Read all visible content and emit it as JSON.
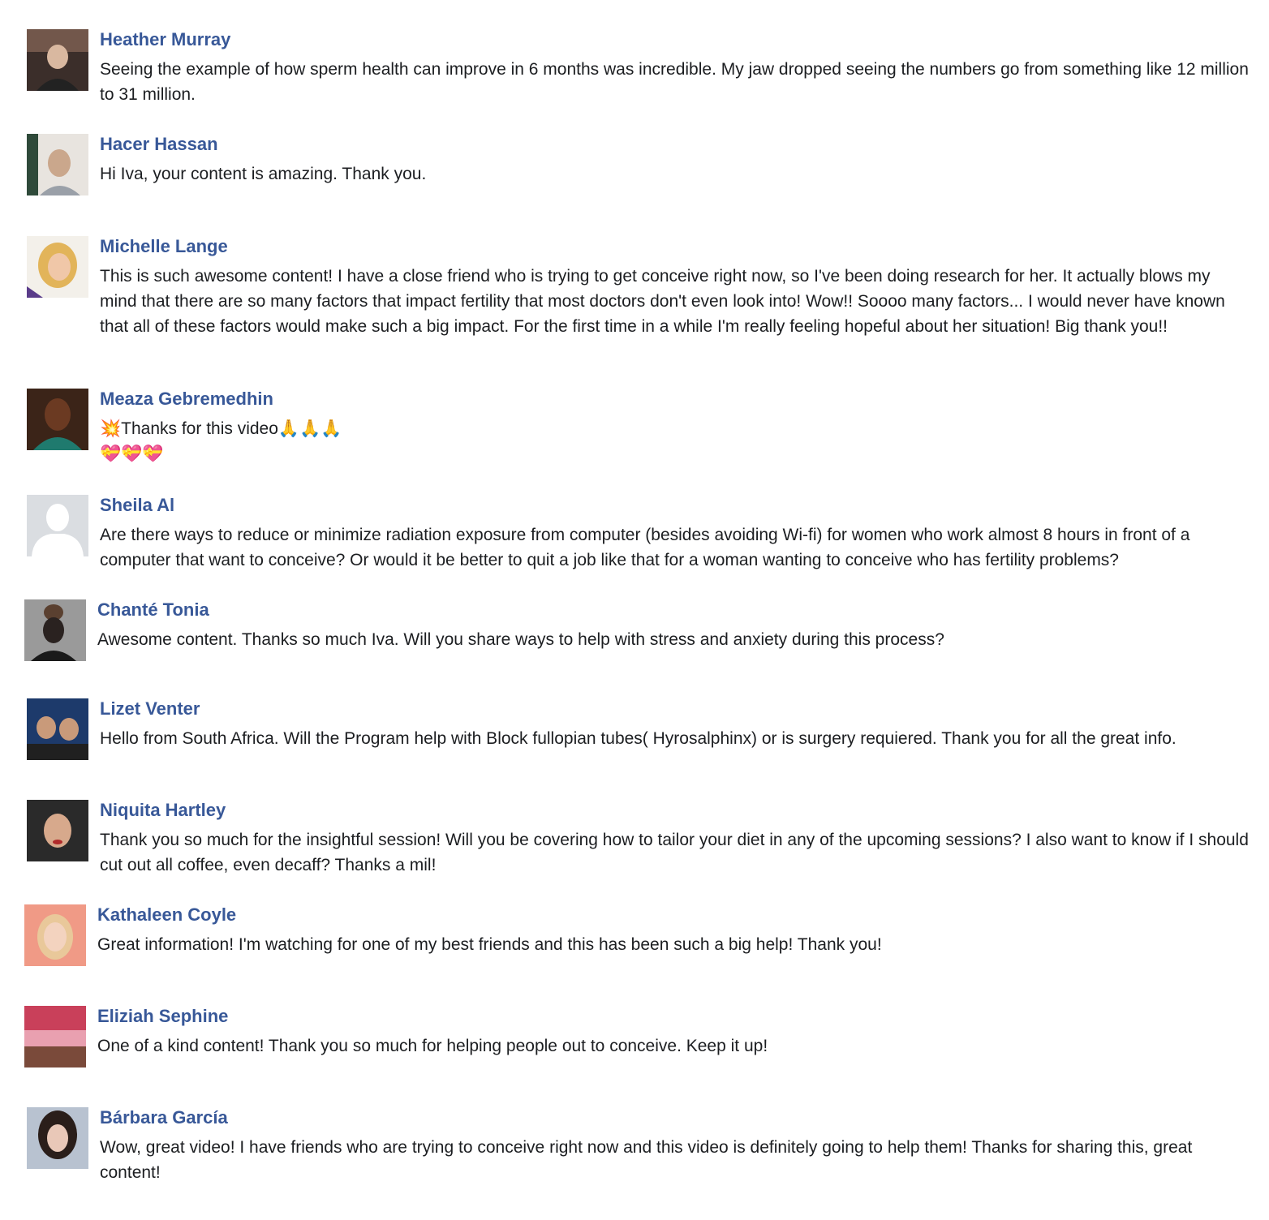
{
  "comments": [
    {
      "name": "Heather Murray",
      "text": "Seeing the example of how sperm health can improve in 6 months was incredible. My jaw dropped seeing the numbers go from something like 12 million to 31 million.",
      "avatar_colors": [
        "#3b2e2a",
        "#8a6a5a",
        "#d9b8a0"
      ]
    },
    {
      "name": "Hacer Hassan",
      "text": "Hi Iva, your content is amazing. Thank you.",
      "avatar_colors": [
        "#e8e4df",
        "#caa78c",
        "#2f4a3a"
      ]
    },
    {
      "name": "Michelle Lange",
      "text": "This is such awesome content! I have a close friend who is trying to get conceive right now, so I've been doing research for her. It actually blows my mind that there are so many factors that impact fertility that most doctors don't even look into! Wow!! Soooo many factors... I would never have known that all of these factors would make such a big impact. For the first time in a while I'm really feeling hopeful about her situation! Big thank you!!",
      "avatar_colors": [
        "#f3f0ea",
        "#e2b45a",
        "#f0c7a8"
      ]
    },
    {
      "name": "Meaza Gebremedhin",
      "text": "💥Thanks for this video🙏🙏🙏\n💝💝💝",
      "avatar_colors": [
        "#3b2418",
        "#6b3a22",
        "#1f7a6e"
      ]
    },
    {
      "name": "Sheila Al",
      "text": "Are there ways to reduce or minimize radiation exposure from computer (besides avoiding Wi-fi) for women who work almost 8 hours in front of a computer that want to conceive? Or would it be better to quit a job like that for a woman wanting to conceive who has fertility problems?",
      "avatar_colors": [
        "#dadde1",
        "#ffffff",
        "#ffffff"
      ]
    },
    {
      "name": "Chanté Tonia",
      "text": "Awesome content. Thanks so much Iva. Will you share ways to help with stress and anxiety during this process?",
      "avatar_colors": [
        "#9a9a9a",
        "#2a2220",
        "#5a4030"
      ]
    },
    {
      "name": "Lizet Venter",
      "text": "Hello from South Africa. Will the Program help with Block fullopian tubes( Hyrosalphinx) or is surgery requiered. Thank you for all the great info.",
      "avatar_colors": [
        "#1d3a6b",
        "#c99a7a",
        "#202020"
      ]
    },
    {
      "name": "Niquita Hartley",
      "text": "Thank you so much for the insightful session! Will you be covering how to tailor your diet in any of the upcoming sessions? I also want to know if I should cut out all coffee, even decaff? Thanks a mil!",
      "avatar_colors": [
        "#2a2a2a",
        "#d7a98c",
        "#b02a2a"
      ]
    },
    {
      "name": "Kathaleen Coyle",
      "text": "Great information! I'm watching for one of my best friends and this has been such a big help! Thank you!",
      "avatar_colors": [
        "#f09a86",
        "#e9c89a",
        "#f3d3bf"
      ]
    },
    {
      "name": "Eliziah Sephine",
      "text": "One of a kind content! Thank you so much for helping people out to conceive. Keep it up!",
      "avatar_colors": [
        "#c9405a",
        "#e9a0b0",
        "#7a4a3a"
      ]
    },
    {
      "name": "Bárbara García",
      "text": "Wow, great video! I have friends who are trying to conceive right now and this video is definitely going to help them! Thanks for sharing this, great content!",
      "avatar_colors": [
        "#2a1e1a",
        "#e9c8b8",
        "#b8c2d0"
      ]
    }
  ]
}
